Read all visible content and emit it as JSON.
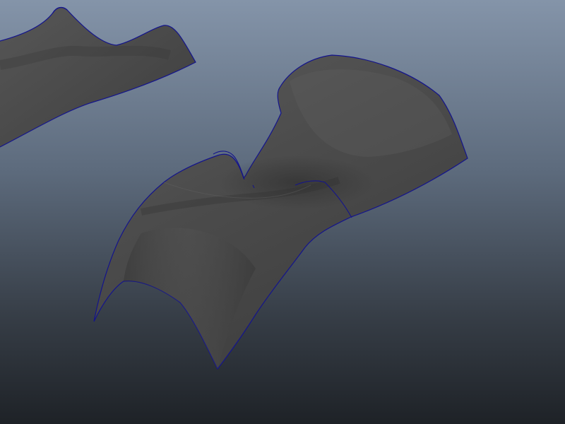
{
  "viewport": {
    "view": "perspective",
    "background_gradient": [
      "#8494a9",
      "#5d6b7d",
      "#363d46",
      "#1e2227"
    ]
  },
  "scene": {
    "surfaces": [
      {
        "id": "nurbs-surface-back",
        "color": "#4a4a4a",
        "edge_color": "#14148c"
      },
      {
        "id": "nurbs-surface-front",
        "color": "#4f4f4f",
        "edge_color": "#14148c"
      }
    ]
  }
}
